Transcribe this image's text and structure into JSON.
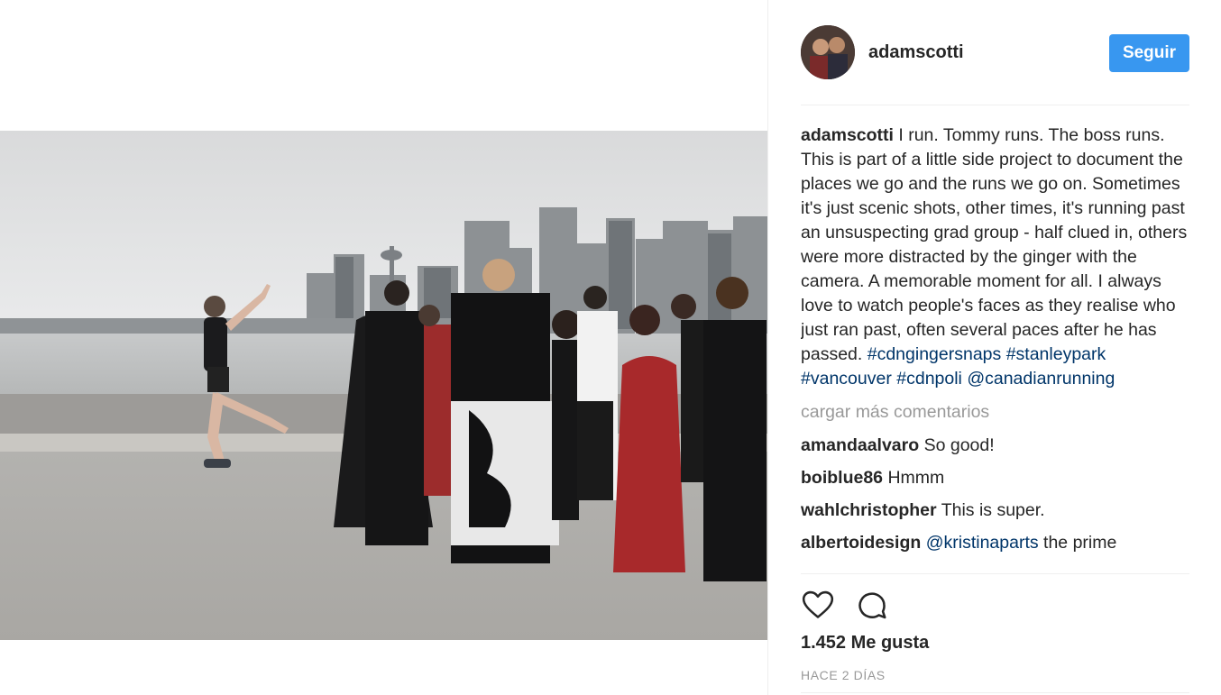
{
  "post": {
    "username": "adamscotti",
    "follow_label": "Seguir",
    "caption_user": "adamscotti",
    "caption_text": "I run. Tommy runs. The boss runs. This is part of a little side project to document the places we go and the runs we go on. Sometimes it's just scenic shots, other times, it's running past an unsuspecting grad group - half clued in, others were more distracted by the ginger with the camera. A memorable moment for all. I always love to watch people's faces as they realise who just ran past, often several paces after he has passed.",
    "hashtags": [
      "#cdngingersnaps",
      "#stanleypark",
      "#vancouver",
      "#cdnpoli",
      "@canadianrunning"
    ],
    "load_more_label": "cargar más comentarios",
    "comments": [
      {
        "user": "amandaalvaro",
        "text": "So good!"
      },
      {
        "user": "boiblue86",
        "text": "Hmmm"
      },
      {
        "user": "wahlchristopher",
        "text": "This is super."
      },
      {
        "user": "albertoidesign",
        "mention": "@kristinaparts",
        "text": "the prime"
      }
    ],
    "likes_label": "1.452 Me gusta",
    "time_label": "HACE 2 DÍAS"
  },
  "icons": {
    "like": "heart-icon",
    "comment": "comment-bubble-icon"
  },
  "colors": {
    "follow_button": "#3897f0",
    "hashtag": "#003569",
    "muted": "#999999",
    "text": "#262626"
  }
}
